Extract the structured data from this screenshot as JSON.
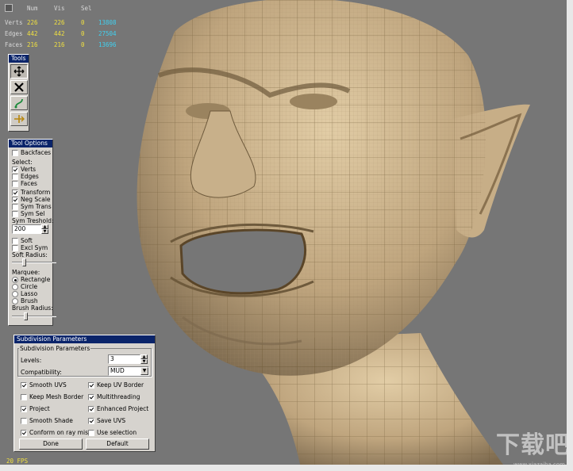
{
  "stats": {
    "headers": [
      "Num",
      "Vis",
      "Sel"
    ],
    "rows": [
      {
        "label": "Verts",
        "num": "226",
        "vis": "226",
        "sel": "0",
        "total": "13808"
      },
      {
        "label": "Edges",
        "num": "442",
        "vis": "442",
        "sel": "0",
        "total": "27504"
      },
      {
        "label": "Faces",
        "num": "216",
        "vis": "216",
        "sel": "0",
        "total": "13696"
      }
    ]
  },
  "tools": {
    "title": "Tools",
    "buttons": [
      {
        "icon": "move-arrows-icon"
      },
      {
        "icon": "delete-x-icon"
      },
      {
        "icon": "relax-curve-icon"
      },
      {
        "icon": "slide-edge-icon"
      }
    ]
  },
  "tool_options": {
    "title": "Tool Options",
    "backfaces": "Backfaces",
    "select_label": "Select:",
    "select_items": [
      "Verts",
      "Edges",
      "Faces"
    ],
    "transform": "Transform",
    "neg_scale": "Neg Scale",
    "sym_trans": "Sym Trans",
    "sym_sel": "Sym Sel",
    "sym_treshold_label": "Sym Treshold:",
    "sym_treshold_value": "200",
    "soft": "Soft",
    "excl_sym": "Excl Sym",
    "soft_radius_label": "Soft Radius:",
    "soft_radius_level": 0.25,
    "marquee_label": "Marquee:",
    "marquee_items": [
      "Rectangle",
      "Circle",
      "Lasso",
      "Brush"
    ],
    "marquee_selected": "Rectangle",
    "brush_radius_label": "Brush Radius:",
    "brush_radius_level": 0.3
  },
  "subdivision": {
    "window_title": "Subdivision Parameters",
    "group_title": "Subdivision Parameters",
    "levels_label": "Levels:",
    "levels_value": "3",
    "compat_label": "Compatibility:",
    "compat_value": "MUD",
    "smooth_uvs": "Smooth UVS",
    "keep_uv_border": "Keep UV Border",
    "keep_mesh_border": "Keep Mesh Border",
    "multithreading": "Multithreading",
    "project": "Project",
    "enhanced_project": "Enhanced Project",
    "smooth_shade": "Smooth Shade",
    "save_uvs": "Save UVS",
    "conform_on_ray_miss": "Conform on ray miss",
    "use_selection": "Use selection",
    "done": "Done",
    "default": "Default"
  },
  "fps": "20 FPS",
  "watermark": "下载吧",
  "watermark_url": "www.xiazaiba.com"
}
